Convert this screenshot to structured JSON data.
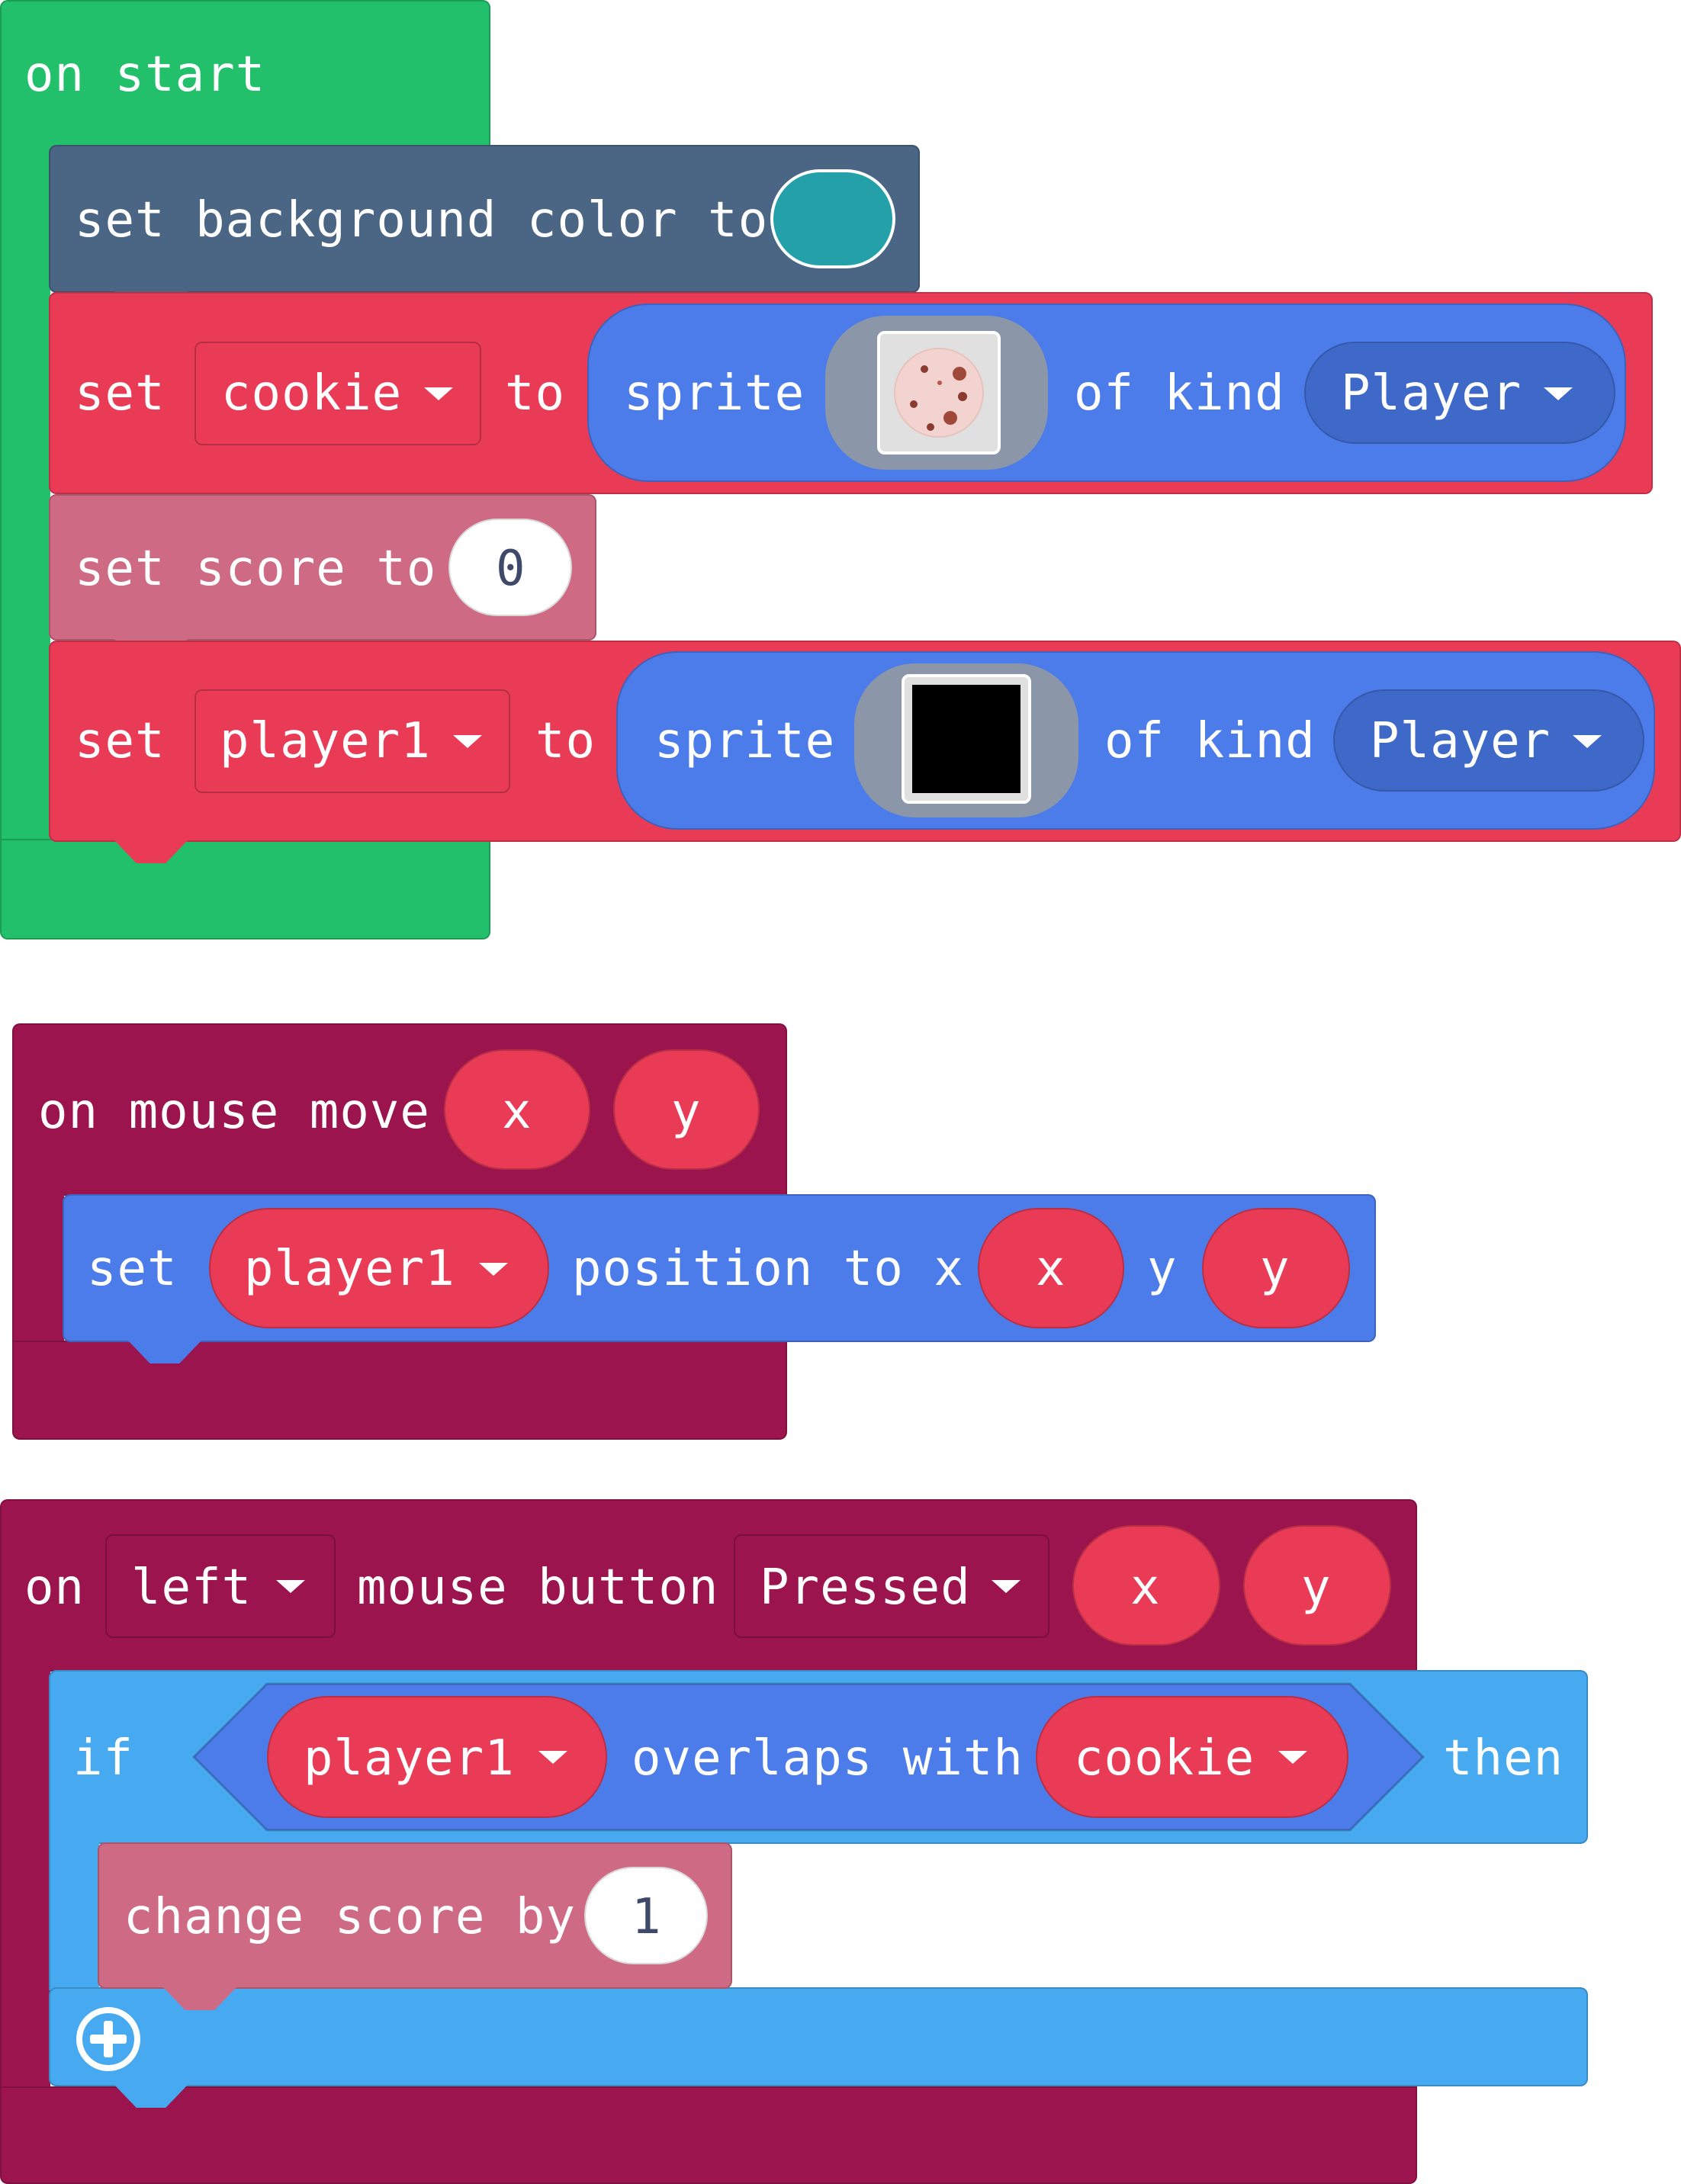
{
  "colors": {
    "event_green": "#22c06a",
    "scene_slate": "#4b6584",
    "sprite_red": "#e93b56",
    "info_pink": "#cf6a84",
    "sprite_blue": "#4c7bea",
    "controller_maroon": "#9b144e",
    "logic_lightblue": "#47a9f0",
    "teal_swatch": "#24a0a8"
  },
  "on_start": {
    "hat_label": "on start",
    "set_background": {
      "label": "set background color to",
      "swatch_icon": "color-swatch-teal"
    },
    "set_cookie": {
      "set_label": "set",
      "variable": "cookie",
      "to_label": "to",
      "sprite_label": "sprite",
      "sprite_icon": "cookie-image",
      "of_kind_label": "of kind",
      "kind": "Player"
    },
    "set_score": {
      "label": "set score to",
      "value": "0"
    },
    "set_player1": {
      "set_label": "set",
      "variable": "player1",
      "to_label": "to",
      "sprite_label": "sprite",
      "sprite_icon": "black-square-image",
      "of_kind_label": "of kind",
      "kind": "Player"
    }
  },
  "on_mouse_move": {
    "hat_label": "on mouse move",
    "param_x": "x",
    "param_y": "y",
    "set_position": {
      "set_label": "set",
      "variable": "player1",
      "position_label": "position to x",
      "x_value": "x",
      "y_label": "y",
      "y_value": "y"
    }
  },
  "on_mouse_button": {
    "on_label": "on",
    "button": "left",
    "mouse_button_label": "mouse button",
    "event": "Pressed",
    "param_x": "x",
    "param_y": "y",
    "if_block": {
      "if_label": "if",
      "sprite_a": "player1",
      "overlaps_label": "overlaps with",
      "sprite_b": "cookie",
      "then_label": "then",
      "change_score": {
        "label": "change score by",
        "value": "1"
      },
      "add_icon": "plus-circle-icon"
    }
  }
}
